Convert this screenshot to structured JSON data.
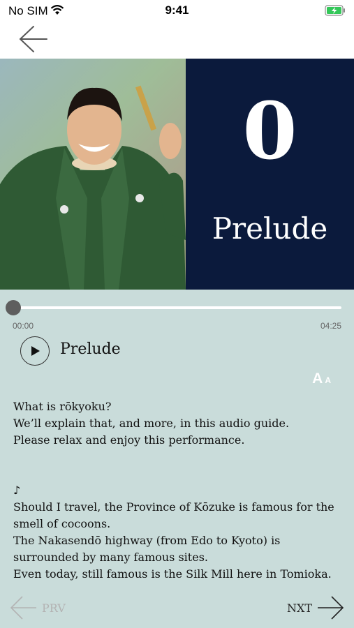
{
  "status": {
    "carrier": "No SIM",
    "time": "9:41"
  },
  "hero": {
    "number": "0",
    "title": "Prelude"
  },
  "player": {
    "elapsed": "00:00",
    "duration": "04:25",
    "progress": 0,
    "track_title": "Prelude"
  },
  "font_size": {
    "large": "A",
    "small": "A"
  },
  "lyrics": {
    "intro": [
      "What is rōkyoku?",
      " We’ll explain that, and more, in this audio guide.",
      " Please relax and enjoy this performance."
    ],
    "note": "♪",
    "verse": [
      " Should I travel, the Province of Kōzuke is famous for the smell of cocoons.",
      " The Nakasendō highway (from Edo to Kyoto) is surrounded by many famous sites.",
      " Even today, still famous is the Silk Mill here in Tomioka."
    ]
  },
  "footer": {
    "prev_label": "PRV",
    "next_label": "NXT"
  }
}
